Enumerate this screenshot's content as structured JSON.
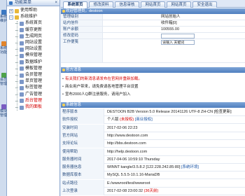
{
  "vertical_tabs": [
    {
      "label": "系统维护",
      "color": "#3b78c2"
    },
    {
      "label": "系统功能",
      "color": "#e2842a"
    },
    {
      "label": "会员管理",
      "color": "#4ea24a"
    },
    {
      "label": "模块管理",
      "color": "#7a5cc2"
    }
  ],
  "sidebar": {
    "title": "功能菜单",
    "close": "×",
    "items": [
      {
        "label": "使用帮助",
        "level": 0,
        "exp": "+",
        "color": "#e8b73a",
        "red": false
      },
      {
        "label": "系统维护",
        "level": 0,
        "exp": "−",
        "color": "#e8b73a",
        "red": false
      },
      {
        "label": "系统首页",
        "level": 1,
        "color": "#7c97c8",
        "red": false
      },
      {
        "label": "缓存更新",
        "level": 1,
        "color": "#7c97c8",
        "red": false
      },
      {
        "label": "生成网页",
        "level": 1,
        "color": "#7c97c8",
        "red": false
      },
      {
        "label": "网站设置",
        "level": 1,
        "color": "#7c97c8",
        "red": false
      },
      {
        "label": "网站设置",
        "level": 1,
        "color": "#7c97c8",
        "red": false
      },
      {
        "label": "模块管理",
        "level": 1,
        "color": "#7c97c8",
        "red": false
      },
      {
        "label": "数据维护",
        "level": 1,
        "color": "#7c97c8",
        "red": false
      },
      {
        "label": "模板管理",
        "level": 1,
        "color": "#7c97c8",
        "red": false
      },
      {
        "label": "会员管理",
        "level": 1,
        "color": "#7c97c8",
        "red": false
      },
      {
        "label": "单页管理",
        "level": 1,
        "color": "#7c97c8",
        "red": false
      },
      {
        "label": "标签管理",
        "level": 1,
        "color": "#7c97c8",
        "red": false
      },
      {
        "label": "广告管理",
        "level": 1,
        "color": "#7c97c8",
        "red": false
      },
      {
        "label": "后台管理",
        "level": 1,
        "color": "#7c97c8",
        "red": true
      },
      {
        "label": "我的面板",
        "level": 1,
        "color": "#7c97c8",
        "red": true
      }
    ]
  },
  "tabs": [
    "系统首页",
    "修改资料",
    "信息审核",
    "网站首页",
    "网站首页",
    "安全退出"
  ],
  "active_tab": 0,
  "admin": {
    "section_title": "欢迎管理员，destoon",
    "rows": [
      {
        "label": "管理级别",
        "value": "网站创始人",
        "type": "text"
      },
      {
        "label": "站内信件",
        "value": "收件箱[0]",
        "type": "text"
      },
      {
        "label": "账户余额",
        "value": "100555.00",
        "type": "text"
      },
      {
        "label": "修改密码",
        "value": "",
        "placeholder": "",
        "type": "input"
      },
      {
        "label": "工作便笺",
        "value": "请输入 关键词",
        "type": "input"
      }
    ]
  },
  "notices": {
    "section_title": "官方消息",
    "items": [
      {
        "text": "有关我们的新消息请发布在官网并重新加载。",
        "red": true
      },
      {
        "text": "商业用户带来，请免费请各地管理平台设置",
        "red": false
      },
      {
        "text": "宣布2000人Q群注册服务，请用户加入",
        "red": false
      }
    ]
  },
  "sysinfo": {
    "section_title": "系统信息",
    "rows": [
      {
        "label": "程序版本",
        "parts": [
          {
            "t": "DESTOON B2B Version 5.0 Release 20141126 UTF-8 ZH-CN [检查更新]",
            "c": ""
          }
        ]
      },
      {
        "label": "软件授权",
        "parts": [
          {
            "t": "个人版 ",
            "c": ""
          },
          {
            "t": "(未授权)",
            "c": "red"
          },
          {
            "t": " [商业授权]",
            "c": "link"
          }
        ]
      },
      {
        "label": "安装时间",
        "parts": [
          {
            "t": "2017-02-06 22:23",
            "c": ""
          }
        ]
      },
      {
        "label": "官方网站",
        "parts": [
          {
            "t": "http://www.destoon.com",
            "c": ""
          }
        ]
      },
      {
        "label": "支持论坛",
        "parts": [
          {
            "t": "http://bbs.destoon.com",
            "c": ""
          }
        ]
      },
      {
        "label": "使用帮助",
        "parts": [
          {
            "t": "http://help.destoon.com",
            "c": ""
          }
        ]
      },
      {
        "label": "服务器时间",
        "parts": [
          {
            "t": "2017-04-06 10:59:10 Thursday",
            "c": ""
          }
        ]
      },
      {
        "label": "服务器信息",
        "parts": [
          {
            "t": "WINNT kangle/3.5.8.2 [122.228.242.85:80] ",
            "c": ""
          },
          {
            "t": "[系统环境]",
            "c": "link"
          }
        ]
      },
      {
        "label": "数据库版本",
        "parts": [
          {
            "t": "MySQL 5.5.5-10.1.16-MariaDB",
            "c": ""
          }
        ]
      },
      {
        "label": "站点路径",
        "parts": [
          {
            "t": "E:/wwwroot/test/wwwroot",
            "c": ""
          }
        ]
      },
      {
        "label": "上次登录",
        "parts": [
          {
            "t": "2017-02-08 23:00:32 ",
            "c": ""
          },
          {
            "t": "(36天前)",
            "c": "red"
          }
        ]
      }
    ]
  }
}
